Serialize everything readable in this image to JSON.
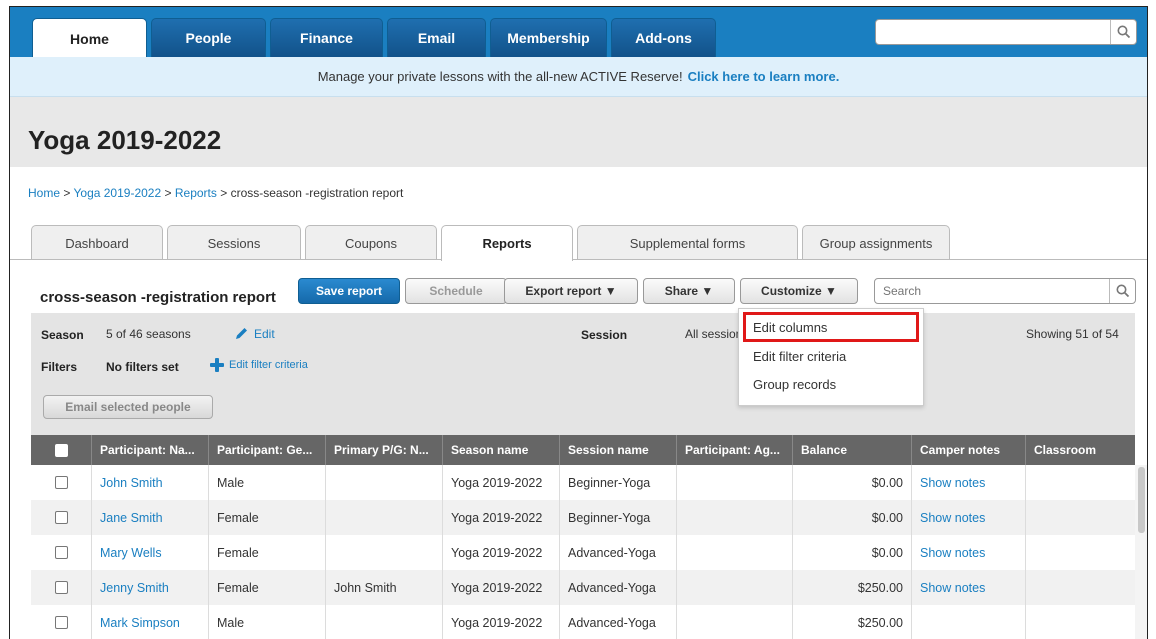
{
  "nav": {
    "tabs": [
      "Home",
      "People",
      "Finance",
      "Email",
      "Membership",
      "Add-ons"
    ],
    "active": "Home",
    "search_placeholder": ""
  },
  "banner": {
    "text": "Manage your private lessons with the all-new ACTIVE Reserve!",
    "link": "Click here to learn more."
  },
  "page": {
    "title": "Yoga 2019-2022",
    "breadcrumb": [
      "Home",
      "Yoga 2019-2022",
      "Reports",
      "cross-season -registration report"
    ],
    "breadcrumb_sep": ">"
  },
  "subtabs": {
    "items": [
      "Dashboard",
      "Sessions",
      "Coupons",
      "Reports",
      "Supplemental forms",
      "Group assignments"
    ],
    "active": "Reports"
  },
  "report": {
    "title": "cross-season -registration report",
    "buttons": {
      "save": "Save report",
      "schedule": "Schedule",
      "export": "Export report ▼",
      "share": "Share ▼",
      "customize": "Customize ▼"
    },
    "search_placeholder": "Search"
  },
  "filters": {
    "season_label": "Season",
    "season_value": "5 of 46 seasons",
    "season_edit": "Edit",
    "session_label": "Session",
    "session_value": "All session",
    "showing": "Showing 51 of 54",
    "filters_label": "Filters",
    "filters_value": "No filters set",
    "edit_filter": "Edit filter criteria",
    "email_selected": "Email selected people"
  },
  "customize_menu": {
    "items": [
      "Edit columns",
      "Edit filter criteria",
      "Group records"
    ],
    "highlighted": "Edit columns"
  },
  "table": {
    "headers": [
      "Participant: Na...",
      "Participant: Ge...",
      "Primary P/G: N...",
      "Season name",
      "Session name",
      "Participant: Ag...",
      "Balance",
      "Camper notes",
      "Classroom"
    ],
    "rows": [
      {
        "name": "John Smith",
        "gender": "Male",
        "primary": "",
        "season": "Yoga 2019-2022",
        "session": "Beginner-Yoga",
        "age": "",
        "balance": "$0.00",
        "notes": "Show notes",
        "classroom": ""
      },
      {
        "name": "Jane Smith",
        "gender": "Female",
        "primary": "",
        "season": "Yoga 2019-2022",
        "session": "Beginner-Yoga",
        "age": "",
        "balance": "$0.00",
        "notes": "Show notes",
        "classroom": ""
      },
      {
        "name": "Mary Wells",
        "gender": "Female",
        "primary": "",
        "season": "Yoga 2019-2022",
        "session": "Advanced-Yoga",
        "age": "",
        "balance": "$0.00",
        "notes": "Show notes",
        "classroom": ""
      },
      {
        "name": "Jenny Smith",
        "gender": "Female",
        "primary": "John Smith",
        "season": "Yoga 2019-2022",
        "session": "Advanced-Yoga",
        "age": "",
        "balance": "$250.00",
        "notes": "Show notes",
        "classroom": ""
      },
      {
        "name": "Mark Simpson",
        "gender": "Male",
        "primary": "",
        "season": "Yoga 2019-2022",
        "session": "Advanced-Yoga",
        "age": "",
        "balance": "$250.00",
        "notes": "",
        "classroom": ""
      }
    ]
  },
  "colors": {
    "brand_blue": "#1a7fc1",
    "banner_bg": "#dff0fb",
    "header_gray": "#666666",
    "highlight_red": "#e01818"
  },
  "icons": {
    "search": "search-icon",
    "edit": "pencil-icon",
    "add": "plus-icon"
  }
}
